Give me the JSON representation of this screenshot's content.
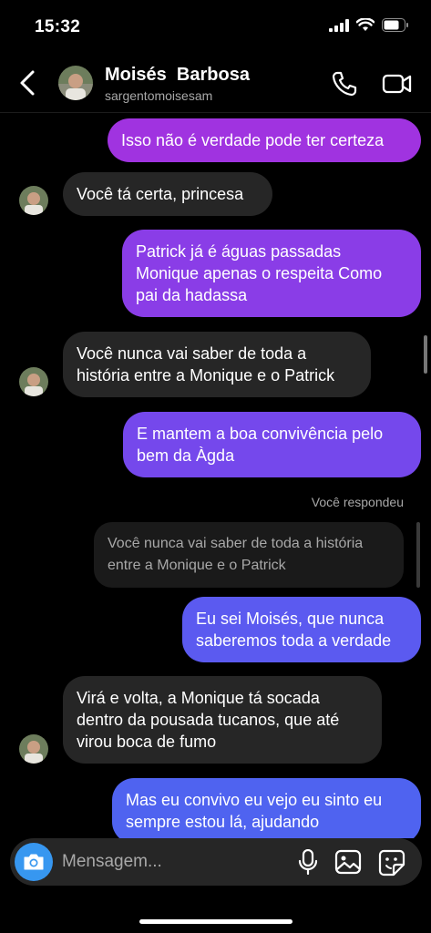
{
  "status_bar": {
    "time": "15:32"
  },
  "header": {
    "name": "Moisés  Barbosa",
    "username": "sargentomoisesam"
  },
  "messages": [
    {
      "direction": "out",
      "text": "Isso não é verdade pode ter certeza"
    },
    {
      "direction": "in",
      "text": "Você tá certa, princesa"
    },
    {
      "direction": "out",
      "text": "Patrick já é águas passadas Monique apenas o respeita Como pai da hadassa"
    },
    {
      "direction": "in",
      "text": "Você nunca vai saber de toda a história entre a Monique e o Patrick"
    },
    {
      "direction": "out",
      "text": "E mantem a boa convivência pelo bem da Àgda"
    },
    {
      "direction": "out",
      "text": "Eu sei Moisés, que nunca saberemos toda a verdade"
    },
    {
      "direction": "in",
      "text": "Virá e volta, a Monique tá socada dentro da pousada tucanos, que até virou boca de fumo"
    },
    {
      "direction": "out",
      "text": "Mas eu convivo eu vejo eu sinto eu sempre estou lá, ajudando"
    }
  ],
  "reply": {
    "label": "Você respondeu",
    "quoted_text": "Você nunca vai saber de toda a história entre a Monique e o Patrick"
  },
  "composer": {
    "placeholder": "Mensagem..."
  },
  "colors": {
    "out_bubble_top": "#a033e0",
    "out_bubble_bottom": "#4f63f0",
    "in_bubble": "#262626",
    "camera_button": "#3797f0"
  }
}
